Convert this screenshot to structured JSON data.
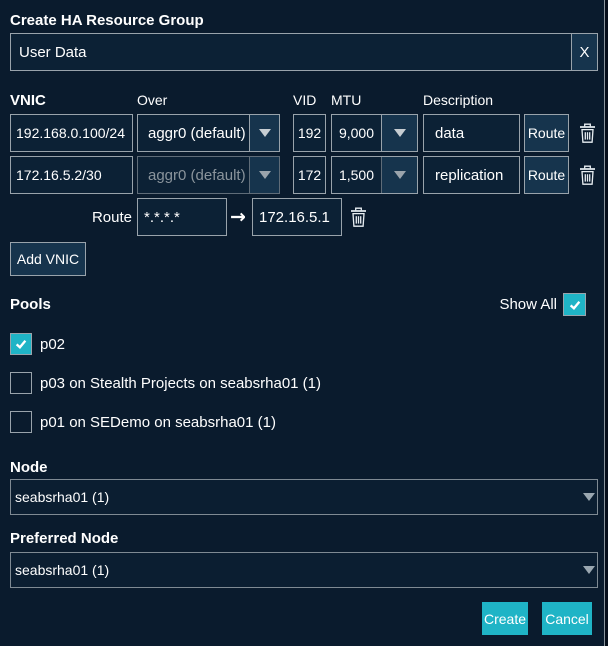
{
  "dialog": {
    "title": "Create HA Resource Group"
  },
  "name_field": {
    "value": "User Data",
    "clear_label": "X"
  },
  "vnic_table": {
    "headers": {
      "vnic": "VNIC",
      "over": "Over",
      "vid": "VID",
      "mtu": "MTU",
      "description": "Description"
    },
    "rows": [
      {
        "vnic": "192.168.0.100/24",
        "over": "aggr0 (default)",
        "over_disabled": false,
        "vid": "192",
        "mtu": "9,000",
        "description": "data",
        "route_label": "Route"
      },
      {
        "vnic": "172.16.5.2/30",
        "over": "aggr0 (default)",
        "over_disabled": true,
        "vid": "172",
        "mtu": "1,500",
        "description": "replication",
        "route_label": "Route"
      }
    ],
    "route_row": {
      "label": "Route",
      "destination": "*.*.*.*",
      "arrow": "→",
      "gateway": "172.16.5.1"
    },
    "add_button_label": "Add VNIC"
  },
  "pools": {
    "label": "Pools",
    "show_all_label": "Show All",
    "show_all_checked": true,
    "items": [
      {
        "label": "p02",
        "checked": true
      },
      {
        "label": "p03 on Stealth Projects on seabsrha01 (1)",
        "checked": false
      },
      {
        "label": "p01 on SEDemo on seabsrha01 (1)",
        "checked": false
      }
    ]
  },
  "node": {
    "label": "Node",
    "value": "seabsrha01 (1)"
  },
  "preferred_node": {
    "label": "Preferred Node",
    "value": "seabsrha01 (1)"
  },
  "actions": {
    "create_label": "Create",
    "cancel_label": "Cancel"
  },
  "colors": {
    "accent": "#1fb4c6",
    "panel_bg": "#0a1b2d",
    "input_bg": "#0c2135",
    "button_bg": "#16344d",
    "border": "#99a3ab",
    "disabled_text": "#8a949c"
  }
}
